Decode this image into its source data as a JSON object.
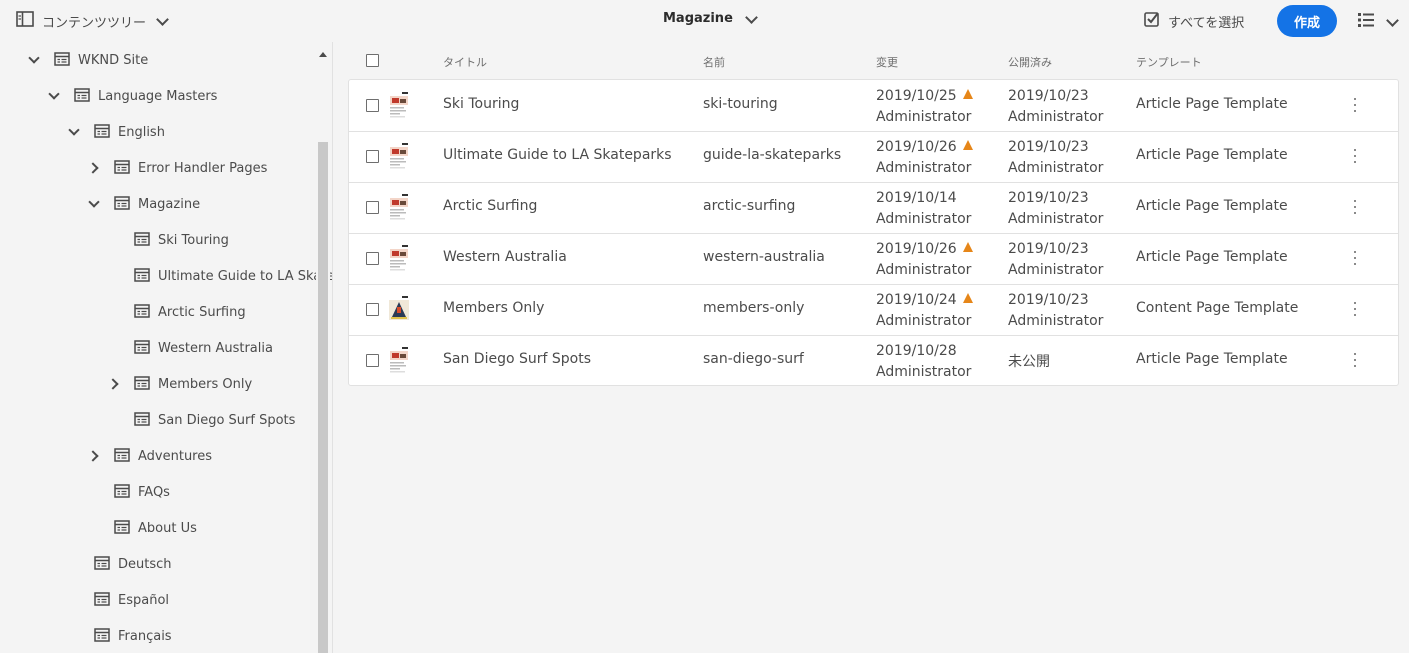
{
  "topbar": {
    "rail_label": "コンテンツツリー",
    "breadcrumb": "Magazine",
    "select_all": "すべてを選択",
    "create": "作成"
  },
  "tree": [
    {
      "label": "WKND Site",
      "expand": "open"
    },
    {
      "label": "Language Masters",
      "expand": "open"
    },
    {
      "label": "English",
      "expand": "open"
    },
    {
      "label": "Error Handler Pages",
      "expand": "closed"
    },
    {
      "label": "Magazine",
      "expand": "open"
    },
    {
      "label": "Ski Touring",
      "expand": "none"
    },
    {
      "label": "Ultimate Guide to LA Skateparks",
      "expand": "none"
    },
    {
      "label": "Arctic Surfing",
      "expand": "none"
    },
    {
      "label": "Western Australia",
      "expand": "none"
    },
    {
      "label": "Members Only",
      "expand": "closed"
    },
    {
      "label": "San Diego Surf Spots",
      "expand": "none"
    },
    {
      "label": "Adventures",
      "expand": "closed"
    },
    {
      "label": "FAQs",
      "expand": "none"
    },
    {
      "label": "About Us",
      "expand": "none"
    },
    {
      "label": "Deutsch",
      "expand": "none"
    },
    {
      "label": "Español",
      "expand": "none"
    },
    {
      "label": "Français",
      "expand": "none"
    }
  ],
  "table": {
    "columns": {
      "title": "タイトル",
      "name": "名前",
      "modified": "変更",
      "published": "公開済み",
      "template": "テンプレート"
    },
    "rows": [
      {
        "title": "Ski Touring",
        "name": "ski-touring",
        "modified_date": "2019/10/25",
        "modified_warning": true,
        "modified_by": "Administrator",
        "published_date": "2019/10/23",
        "published_by": "Administrator",
        "template": "Article Page Template"
      },
      {
        "title": "Ultimate Guide to LA Skateparks",
        "name": "guide-la-skateparks",
        "modified_date": "2019/10/26",
        "modified_warning": true,
        "modified_by": "Administrator",
        "published_date": "2019/10/23",
        "published_by": "Administrator",
        "template": "Article Page Template"
      },
      {
        "title": "Arctic Surfing",
        "name": "arctic-surfing",
        "modified_date": "2019/10/14",
        "modified_warning": false,
        "modified_by": "Administrator",
        "published_date": "2019/10/23",
        "published_by": "Administrator",
        "template": "Article Page Template"
      },
      {
        "title": "Western Australia",
        "name": "western-australia",
        "modified_date": "2019/10/26",
        "modified_warning": true,
        "modified_by": "Administrator",
        "published_date": "2019/10/23",
        "published_by": "Administrator",
        "template": "Article Page Template"
      },
      {
        "title": "Members Only",
        "name": "members-only",
        "modified_date": "2019/10/24",
        "modified_warning": true,
        "modified_by": "Administrator",
        "published_date": "2019/10/23",
        "published_by": "Administrator",
        "template": "Content Page Template"
      },
      {
        "title": "San Diego Surf Spots",
        "name": "san-diego-surf",
        "modified_date": "2019/10/28",
        "modified_warning": false,
        "modified_by": "Administrator",
        "published_date": "未公開",
        "published_by": "",
        "template": "Article Page Template"
      }
    ]
  },
  "colors": {
    "accent": "#1473e6",
    "warning": "#e68619",
    "background": "#f4f4f4"
  }
}
